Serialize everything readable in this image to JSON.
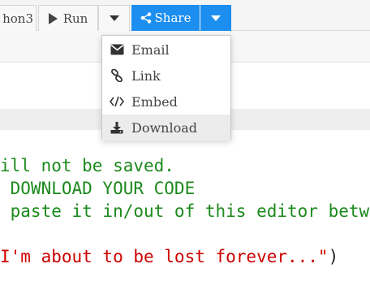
{
  "toolbar": {
    "language_label": "hon3",
    "run_label": "Run",
    "share_label": "Share",
    "share_icon": "share-icon",
    "caret_icon": "chevron-down-icon"
  },
  "share_menu": {
    "items": [
      {
        "label": "Email",
        "icon": "envelope-icon"
      },
      {
        "label": "Link",
        "icon": "link-icon"
      },
      {
        "label": "Embed",
        "icon": "code-icon"
      },
      {
        "label": "Download",
        "icon": "download-icon"
      }
    ],
    "highlighted": "Download"
  },
  "editor": {
    "lines": [
      "ill not be saved.",
      " DOWNLOAD YOUR CODE",
      " paste it in/out of this editor betw",
      "I'm about to be lost forever...\")"
    ],
    "colors": {
      "comment": "#1c8a1c",
      "string": "#cc0000",
      "text": "#222222"
    }
  },
  "colors": {
    "accent": "#1c8ef0"
  }
}
